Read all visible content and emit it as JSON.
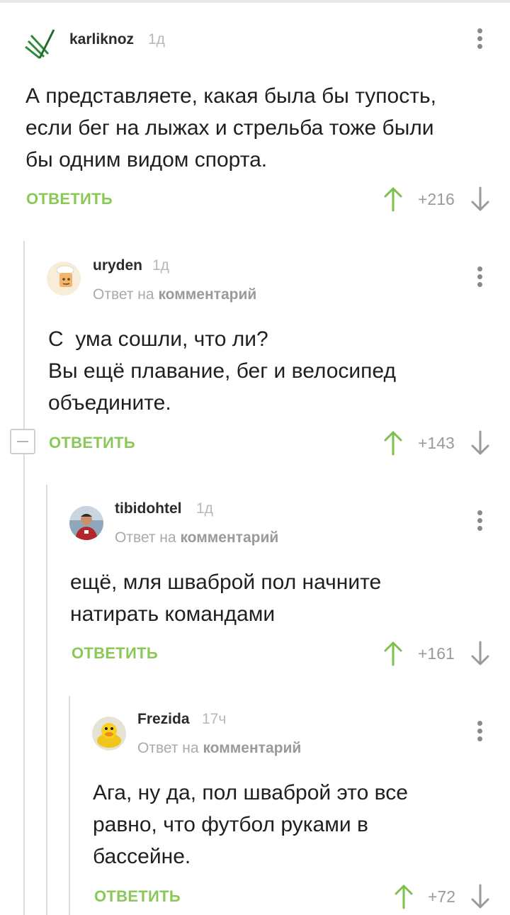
{
  "comments": [
    {
      "username": "karliknoz",
      "time": "1д",
      "reply_prefix": "",
      "reply_target": "",
      "text": "А представляете, какая была бы тупость,\nесли бег на лыжах и стрельба тоже были\nбы одним видом спорта.",
      "reply_label": "ОТВЕТИТЬ",
      "rating": "+216"
    },
    {
      "username": "uryden",
      "time": "1д",
      "reply_prefix": "Ответ на",
      "reply_target": "комментарий",
      "text": "С  ума сошли, что ли?\nВы ещё плавание, бег и велосипед\nобъедините.",
      "reply_label": "ОТВЕТИТЬ",
      "rating": "+143"
    },
    {
      "username": "tibidohtel",
      "time": "1д",
      "reply_prefix": "Ответ на",
      "reply_target": "комментарий",
      "text": "ещё, мля шваброй пол начните\nнатирать командами",
      "reply_label": "ОТВЕТИТЬ",
      "rating": "+161"
    },
    {
      "username": "Frezida",
      "time": "17ч",
      "reply_prefix": "Ответ на",
      "reply_target": "комментарий",
      "text": "Ага, ну да, пол шваброй это все\nравно, что футбол руками в\nбассейне.",
      "reply_label": "ОТВЕТИТЬ",
      "rating": "+72"
    }
  ],
  "colors": {
    "accent_green": "#8ac858",
    "thread_line": "#dcdcdc",
    "muted_text": "#aaaaaa"
  },
  "icons": [
    "more-vertical-icon",
    "arrow-up-icon",
    "arrow-down-icon",
    "collapse-minus-icon"
  ]
}
